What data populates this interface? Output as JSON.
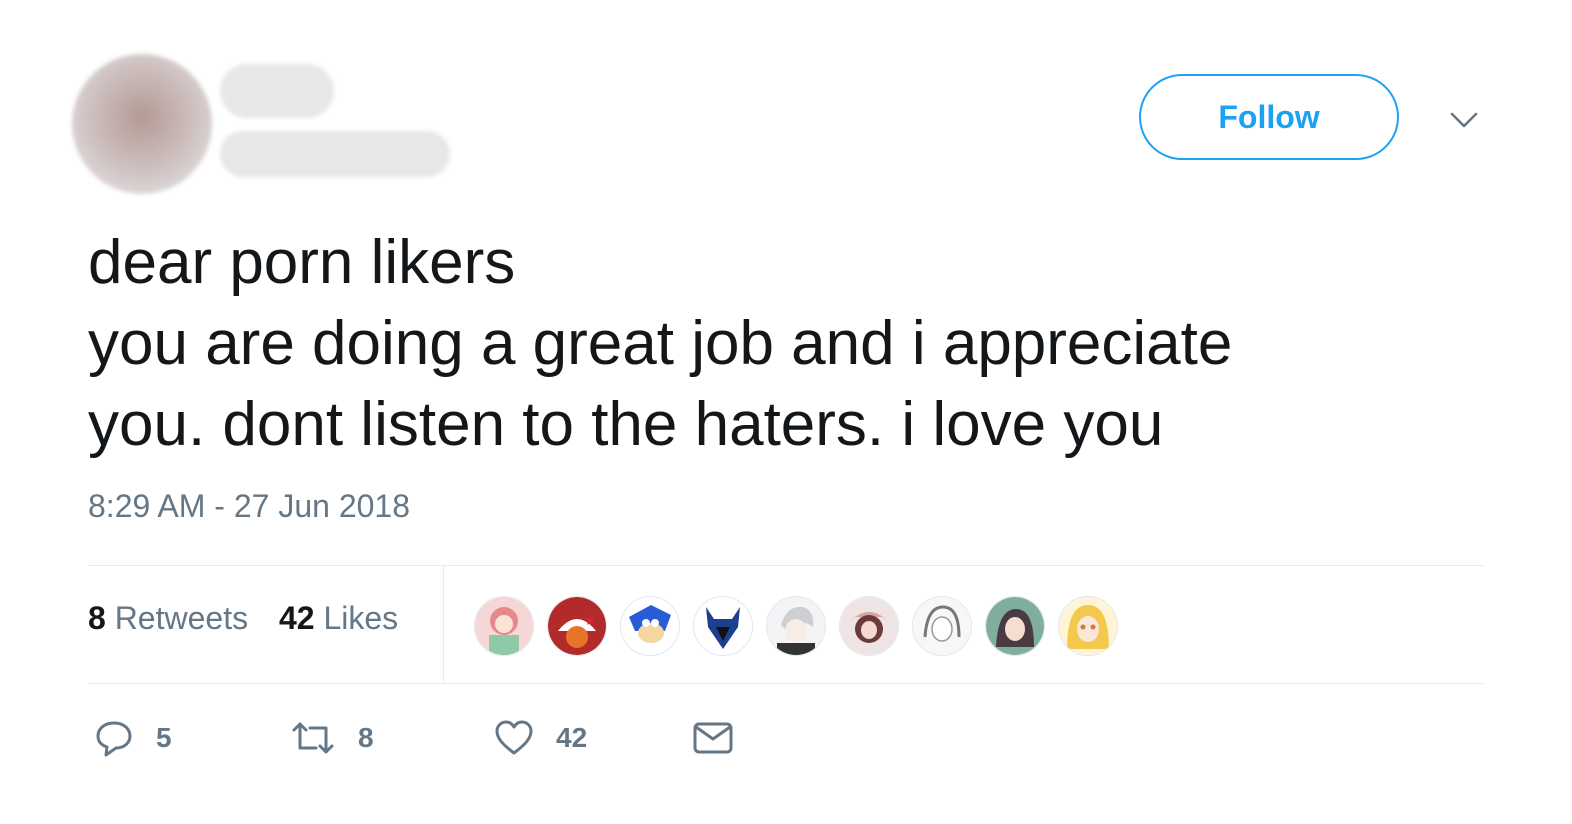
{
  "header": {
    "follow_label": "Follow"
  },
  "tweet": {
    "lines": [
      "dear porn likers",
      "you are doing a great job and i appreciate",
      "you. dont listen to the haters. i love you"
    ],
    "timestamp": "8:29 AM - 27 Jun 2018"
  },
  "stats": {
    "retweets_count": "8",
    "retweets_label": "Retweets",
    "likes_count": "42",
    "likes_label": "Likes"
  },
  "likers": [
    {
      "icon": "liker-avatar-1",
      "color": "#e58a8a"
    },
    {
      "icon": "liker-avatar-2",
      "color": "#e8742a"
    },
    {
      "icon": "liker-avatar-3",
      "color": "#2a5bd7"
    },
    {
      "icon": "liker-avatar-4",
      "color": "#1c3f8f"
    },
    {
      "icon": "liker-avatar-5",
      "color": "#cfcfd3"
    },
    {
      "icon": "liker-avatar-6",
      "color": "#b96a6a"
    },
    {
      "icon": "liker-avatar-7",
      "color": "#d9d9d9"
    },
    {
      "icon": "liker-avatar-8",
      "color": "#5a4a52"
    },
    {
      "icon": "liker-avatar-9",
      "color": "#f2c94c"
    }
  ],
  "actions": {
    "reply_count": "5",
    "retweet_count": "8",
    "like_count": "42"
  },
  "colors": {
    "accent": "#1da1f2",
    "muted": "#657786",
    "text": "#14171a"
  }
}
